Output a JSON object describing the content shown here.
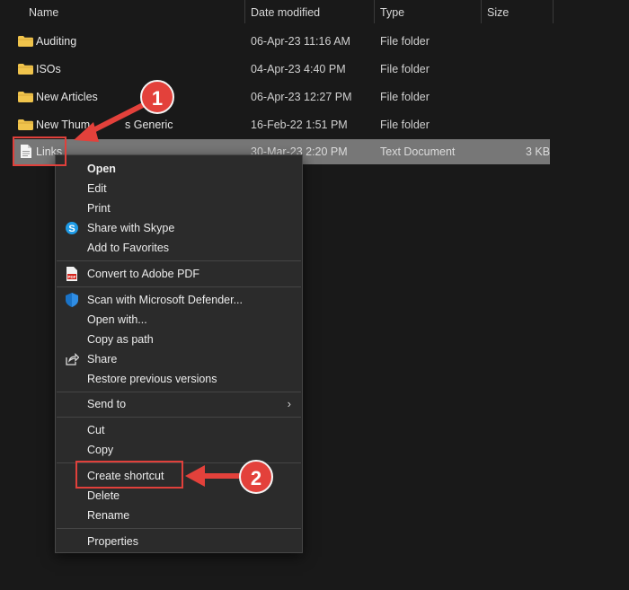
{
  "columns": {
    "name": "Name",
    "date_modified": "Date modified",
    "type": "Type",
    "size": "Size"
  },
  "files": [
    {
      "name": "Auditing",
      "date": "06-Apr-23 11:16 AM",
      "type": "File folder",
      "size": "",
      "icon": "folder-icon"
    },
    {
      "name": "ISOs",
      "date": "04-Apr-23 4:40 PM",
      "type": "File folder",
      "size": "",
      "icon": "folder-icon"
    },
    {
      "name": "New Articles",
      "date": "06-Apr-23 12:27 PM",
      "type": "File folder",
      "size": "",
      "icon": "folder-icon"
    },
    {
      "name": "New Thum",
      "name_tail": "s Generic",
      "date": "16-Feb-22 1:51 PM",
      "type": "File folder",
      "size": "",
      "icon": "folder-icon"
    },
    {
      "name": "Links",
      "date": "30-Mar-23 2:20 PM",
      "type": "Text Document",
      "size": "3 KB",
      "icon": "text-document-icon",
      "selected": true
    }
  ],
  "context_menu": {
    "items": [
      {
        "label": "Open",
        "bold": true
      },
      {
        "label": "Edit"
      },
      {
        "label": "Print"
      },
      {
        "label": "Share with Skype",
        "icon": "skype-icon"
      },
      {
        "label": "Add to Favorites"
      },
      {
        "label": "Convert to Adobe PDF",
        "icon": "adobe-pdf-icon"
      },
      {
        "label": "Scan with Microsoft Defender...",
        "icon": "defender-shield-icon"
      },
      {
        "label": "Open with..."
      },
      {
        "label": "Copy as path"
      },
      {
        "label": "Share",
        "icon": "share-icon"
      },
      {
        "label": "Restore previous versions"
      },
      {
        "label": "Send to",
        "submenu": true
      },
      {
        "label": "Cut"
      },
      {
        "label": "Copy"
      },
      {
        "label": "Create shortcut",
        "highlighted": true
      },
      {
        "label": "Delete"
      },
      {
        "label": "Rename"
      },
      {
        "label": "Properties"
      }
    ]
  },
  "annotations": {
    "step1": "1",
    "step2": "2",
    "color": "#e3413b"
  },
  "colors": {
    "background": "#191919",
    "menu_background": "#2b2b2b",
    "selected_row": "#777777",
    "folder": "#f0c44c"
  }
}
